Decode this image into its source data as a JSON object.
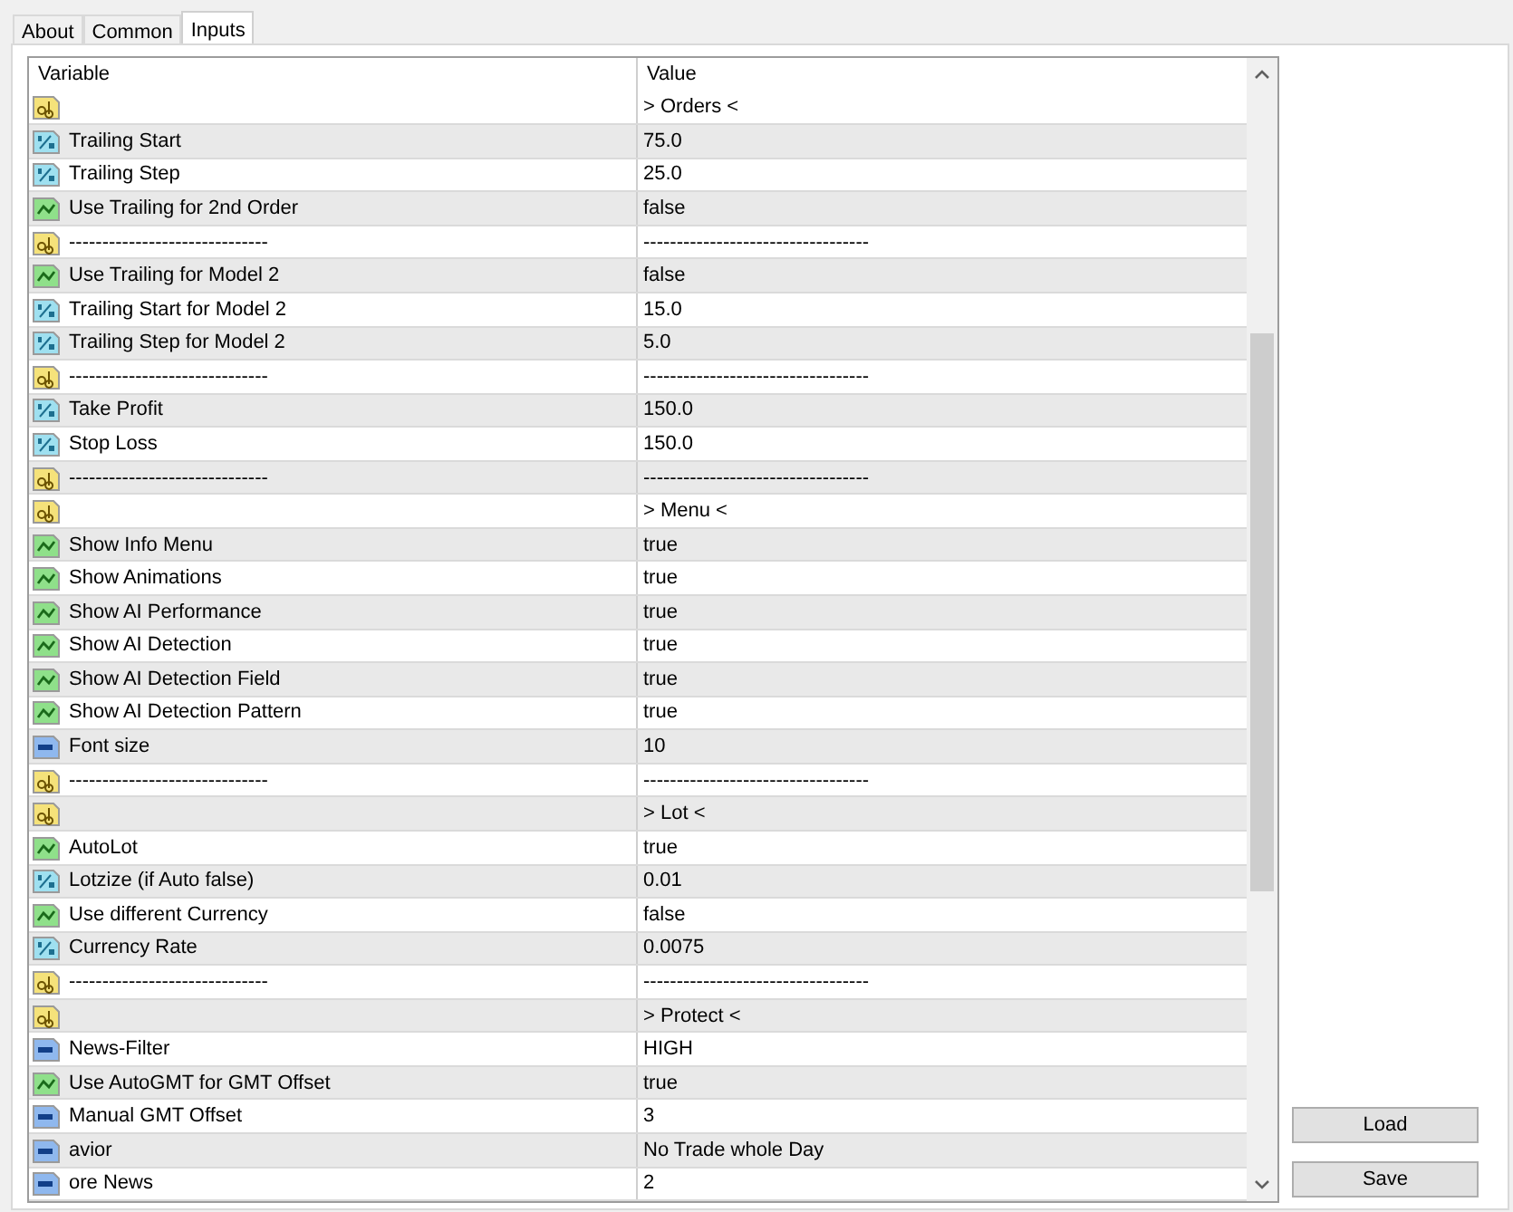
{
  "tabs": [
    {
      "label": "About",
      "selected": false
    },
    {
      "label": "Common",
      "selected": false
    },
    {
      "label": "Inputs",
      "selected": true
    }
  ],
  "table": {
    "columns": [
      "Variable",
      "Value"
    ],
    "rows": [
      {
        "kind": "string",
        "variable": "",
        "value": "> Orders <"
      },
      {
        "kind": "double",
        "variable": "Trailing Start",
        "value": "75.0"
      },
      {
        "kind": "double",
        "variable": "Trailing Step",
        "value": "25.0"
      },
      {
        "kind": "bool",
        "variable": "Use Trailing for 2nd Order",
        "value": "false"
      },
      {
        "kind": "string",
        "variable": "------------------------------",
        "value": "----------------------------------"
      },
      {
        "kind": "bool",
        "variable": "Use Trailing for Model 2",
        "value": "false"
      },
      {
        "kind": "double",
        "variable": "Trailing Start for Model 2",
        "value": "15.0"
      },
      {
        "kind": "double",
        "variable": "Trailing Step for Model 2",
        "value": "5.0"
      },
      {
        "kind": "string",
        "variable": "------------------------------",
        "value": "----------------------------------"
      },
      {
        "kind": "double",
        "variable": "Take Profit",
        "value": "150.0"
      },
      {
        "kind": "double",
        "variable": "Stop Loss",
        "value": "150.0"
      },
      {
        "kind": "string",
        "variable": "------------------------------",
        "value": "----------------------------------"
      },
      {
        "kind": "string",
        "variable": "",
        "value": "> Menu <"
      },
      {
        "kind": "bool",
        "variable": "Show Info Menu",
        "value": "true"
      },
      {
        "kind": "bool",
        "variable": "Show Animations",
        "value": "true"
      },
      {
        "kind": "bool",
        "variable": "Show AI Performance",
        "value": "true"
      },
      {
        "kind": "bool",
        "variable": "Show AI Detection",
        "value": "true"
      },
      {
        "kind": "bool",
        "variable": "Show AI Detection Field",
        "value": "true"
      },
      {
        "kind": "bool",
        "variable": "Show AI Detection Pattern",
        "value": "true"
      },
      {
        "kind": "int",
        "variable": "Font size",
        "value": "10"
      },
      {
        "kind": "string",
        "variable": "------------------------------",
        "value": "----------------------------------"
      },
      {
        "kind": "string",
        "variable": "",
        "value": "> Lot <"
      },
      {
        "kind": "bool",
        "variable": "AutoLot",
        "value": "true"
      },
      {
        "kind": "double",
        "variable": "Lotzize (if Auto false)",
        "value": "0.01"
      },
      {
        "kind": "bool",
        "variable": "Use different Currency",
        "value": "false"
      },
      {
        "kind": "double",
        "variable": "Currency Rate",
        "value": "0.0075"
      },
      {
        "kind": "string",
        "variable": "------------------------------",
        "value": "----------------------------------"
      },
      {
        "kind": "string",
        "variable": "",
        "value": "> Protect <"
      },
      {
        "kind": "int",
        "variable": "News-Filter",
        "value": "HIGH"
      },
      {
        "kind": "bool",
        "variable": "Use AutoGMT for GMT Offset",
        "value": "true"
      },
      {
        "kind": "int",
        "variable": "Manual GMT Offset",
        "value": "3"
      },
      {
        "kind": "int",
        "variable": "avior",
        "value": "No Trade whole Day"
      },
      {
        "kind": "int",
        "variable": "ore News",
        "value": "2"
      }
    ]
  },
  "buttons": [
    "Load",
    "Save"
  ]
}
